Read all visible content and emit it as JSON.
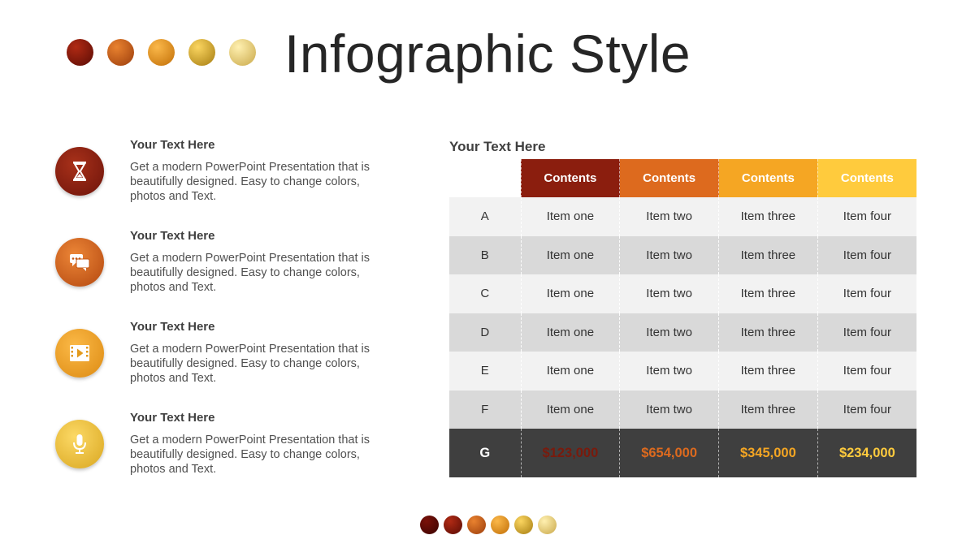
{
  "title": "Infographic Style",
  "colors": {
    "dark_red": "#8B1E0E",
    "orange": "#DD6A1E",
    "amber": "#F5A623",
    "yellow": "#FFCB3D",
    "gray_row_light": "#F2F2F2",
    "gray_row_dark": "#D9D9D9",
    "footer_bg": "#3F3F3F"
  },
  "features": [
    {
      "heading": "Your Text Here",
      "body": "Get a modern PowerPoint  Presentation that is beautifully designed. Easy to change colors, photos and Text.",
      "icon": "hourglass-icon"
    },
    {
      "heading": "Your Text Here",
      "body": "Get a modern PowerPoint  Presentation that is beautifully designed. Easy to change colors, photos and Text.",
      "icon": "chat-bubbles-icon"
    },
    {
      "heading": "Your Text Here",
      "body": "Get a modern PowerPoint  Presentation that is beautifully designed. Easy to change colors, photos and Text.",
      "icon": "video-play-icon"
    },
    {
      "heading": "Your Text Here",
      "body": "Get a modern PowerPoint  Presentation that is beautifully designed. Easy to change colors, photos and Text.",
      "icon": "microphone-icon"
    }
  ],
  "table": {
    "title": "Your Text Here",
    "headers": [
      "Contents",
      "Contents",
      "Contents",
      "Contents"
    ],
    "rows": [
      {
        "label": "A",
        "cells": [
          "Item one",
          "Item two",
          "Item three",
          "Item four"
        ]
      },
      {
        "label": "B",
        "cells": [
          "Item one",
          "Item two",
          "Item three",
          "Item four"
        ]
      },
      {
        "label": "C",
        "cells": [
          "Item one",
          "Item two",
          "Item three",
          "Item four"
        ]
      },
      {
        "label": "D",
        "cells": [
          "Item one",
          "Item two",
          "Item three",
          "Item four"
        ]
      },
      {
        "label": "E",
        "cells": [
          "Item one",
          "Item two",
          "Item three",
          "Item four"
        ]
      },
      {
        "label": "F",
        "cells": [
          "Item one",
          "Item two",
          "Item three",
          "Item four"
        ]
      }
    ],
    "footer": {
      "label": "G",
      "cells": [
        "$123,000",
        "$654,000",
        "$345,000",
        "$234,000"
      ]
    }
  }
}
